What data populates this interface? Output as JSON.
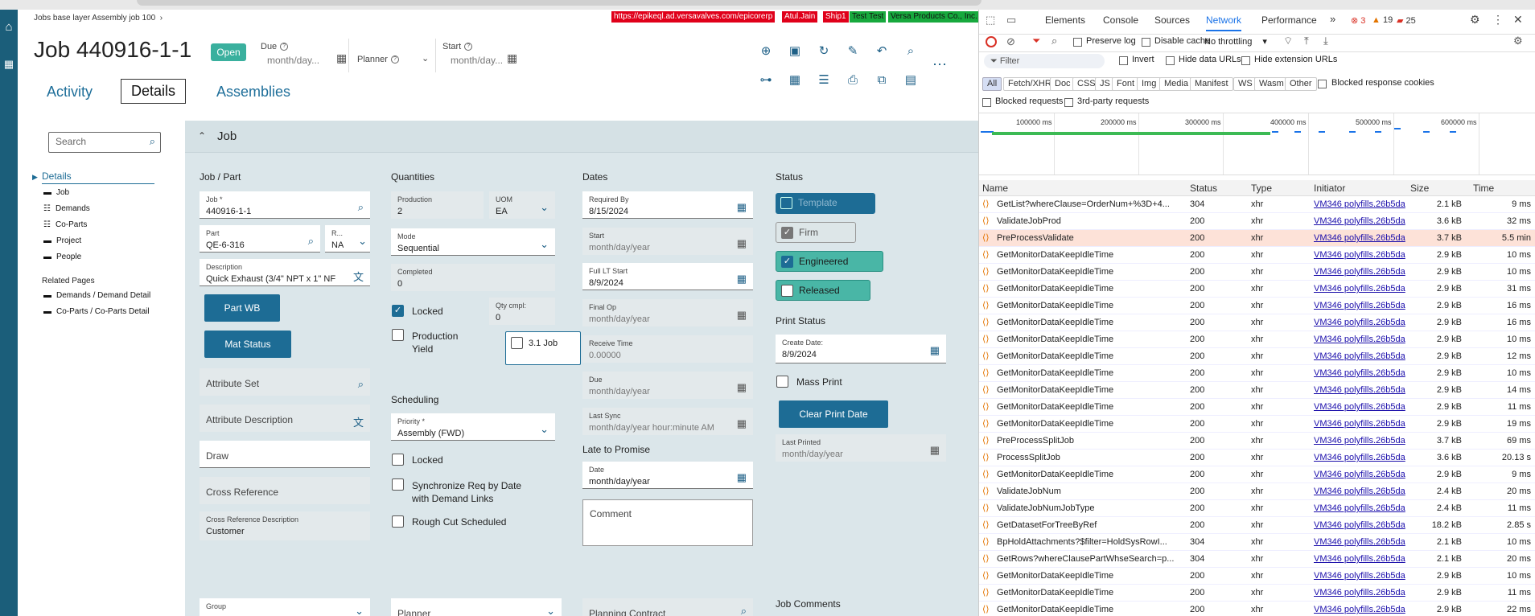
{
  "app": {
    "breadcrumb": "Jobs base layer Assembly job 100",
    "title": "Job 440916-1-1",
    "status_badge": "Open",
    "env": {
      "url": "https://epikeql.ad.versavalves.com/epicorerp",
      "user": "Atul.Jain",
      "ship": "Ship1",
      "test": "Test Test",
      "company": "Versa Products Co., Inc."
    },
    "header": {
      "due_label": "Due",
      "due_value": "month/day...",
      "planner_label": "Planner",
      "start_label": "Start",
      "start_value": "month/day..."
    },
    "tabs": [
      "Activity",
      "Details",
      "Assemblies"
    ],
    "nav": {
      "search_placeholder": "Search",
      "details_label": "Details",
      "items": [
        "Job",
        "Demands",
        "Co-Parts",
        "Project",
        "People"
      ],
      "related_title": "Related Pages",
      "related": [
        "Demands / Demand Detail",
        "Co-Parts / Co-Parts Detail"
      ]
    },
    "section_title": "Job",
    "job_part": {
      "heading": "Job / Part",
      "job_label": "Job *",
      "job_value": "440916-1-1",
      "part_label": "Part",
      "part_value": "QE-6-316",
      "rev_label": "R...",
      "rev_value": "NA",
      "desc_label": "Description",
      "desc_value": "Quick Exhaust (3/4\" NPT x 1\" NF",
      "part_wb": "Part WB",
      "mat_status": "Mat Status",
      "attr_set": "Attribute Set",
      "attr_desc": "Attribute Description",
      "draw": "Draw",
      "cross_ref": "Cross Reference",
      "cross_ref_desc_label": "Cross Reference Description",
      "cross_ref_desc_value": "Customer",
      "group_label": "Group"
    },
    "quantities": {
      "heading": "Quantities",
      "production_label": "Production",
      "production_value": "2",
      "uom_label": "UOM",
      "uom_value": "EA",
      "mode_label": "Mode",
      "mode_value": "Sequential",
      "completed_label": "Completed",
      "completed_value": "0",
      "locked": "Locked",
      "qty_cmpl_label": "Qty cmpl:",
      "qty_cmpl_value": "0",
      "prod_yield": "Production Yield",
      "job31": "3.1 Job",
      "scheduling": "Scheduling",
      "priority_label": "Priority *",
      "priority_value": "Assembly (FWD)",
      "sched_locked": "Locked",
      "sync_req": "Synchronize Req by Date with Demand Links",
      "rough_cut": "Rough Cut Scheduled",
      "planner_label": "Planner"
    },
    "dates": {
      "heading": "Dates",
      "required_label": "Required By",
      "required_value": "8/15/2024",
      "start_label": "Start",
      "start_value": "month/day/year",
      "fulllt_label": "Full LT Start",
      "fulllt_value": "8/9/2024",
      "finalop_label": "Final Op",
      "finalop_value": "month/day/year",
      "receive_label": "Receive Time",
      "receive_value": "0.00000",
      "due_label": "Due",
      "due_value": "month/day/year",
      "lastsync_label": "Last Sync",
      "lastsync_value": "month/day/year hour:minute AM",
      "late_heading": "Late to Promise",
      "date_label": "Date",
      "date_value": "month/day/year",
      "comment_label": "Comment",
      "planning_contract": "Planning Contract"
    },
    "status": {
      "heading": "Status",
      "template": "Template",
      "firm": "Firm",
      "engineered": "Engineered",
      "released": "Released",
      "print_heading": "Print Status",
      "create_label": "Create Date:",
      "create_value": "8/9/2024",
      "mass_print": "Mass Print",
      "clear_print": "Clear Print Date",
      "last_printed_label": "Last Printed",
      "last_printed_value": "month/day/year",
      "job_comments": "Job Comments"
    }
  },
  "devtools": {
    "tabs": [
      "Elements",
      "Console",
      "Sources",
      "Network",
      "Performance"
    ],
    "errors": "3",
    "warnings": "19",
    "issues": "25",
    "preserve_log": "Preserve log",
    "disable_cache": "Disable cache",
    "throttling": "No throttling",
    "filter_placeholder": "Filter",
    "invert": "Invert",
    "hide_data": "Hide data URLs",
    "hide_ext": "Hide extension URLs",
    "types": [
      "All",
      "Fetch/XHR",
      "Doc",
      "CSS",
      "JS",
      "Font",
      "Img",
      "Media",
      "Manifest",
      "WS",
      "Wasm",
      "Other"
    ],
    "blocked_cookies": "Blocked response cookies",
    "blocked_requests": "Blocked requests",
    "third_party": "3rd-party requests",
    "timeline_ticks": [
      "100000 ms",
      "200000 ms",
      "300000 ms",
      "400000 ms",
      "500000 ms",
      "600000 ms"
    ],
    "columns": [
      "Name",
      "Status",
      "Type",
      "Initiator",
      "Size",
      "Time"
    ],
    "rows": [
      [
        "GetList?whereClause=OrderNum+%3D+4...",
        "304",
        "xhr",
        "VM346 polyfills.26b5da",
        "2.1 kB",
        "9 ms"
      ],
      [
        "ValidateJobProd",
        "200",
        "xhr",
        "VM346 polyfills.26b5da",
        "3.6 kB",
        "32 ms"
      ],
      [
        "PreProcessValidate",
        "200",
        "xhr",
        "VM346 polyfills.26b5da",
        "3.7 kB",
        "5.5 min"
      ],
      [
        "GetMonitorDataKeepIdleTime",
        "200",
        "xhr",
        "VM346 polyfills.26b5da",
        "2.9 kB",
        "10 ms"
      ],
      [
        "GetMonitorDataKeepIdleTime",
        "200",
        "xhr",
        "VM346 polyfills.26b5da",
        "2.9 kB",
        "10 ms"
      ],
      [
        "GetMonitorDataKeepIdleTime",
        "200",
        "xhr",
        "VM346 polyfills.26b5da",
        "2.9 kB",
        "31 ms"
      ],
      [
        "GetMonitorDataKeepIdleTime",
        "200",
        "xhr",
        "VM346 polyfills.26b5da",
        "2.9 kB",
        "16 ms"
      ],
      [
        "GetMonitorDataKeepIdleTime",
        "200",
        "xhr",
        "VM346 polyfills.26b5da",
        "2.9 kB",
        "16 ms"
      ],
      [
        "GetMonitorDataKeepIdleTime",
        "200",
        "xhr",
        "VM346 polyfills.26b5da",
        "2.9 kB",
        "10 ms"
      ],
      [
        "GetMonitorDataKeepIdleTime",
        "200",
        "xhr",
        "VM346 polyfills.26b5da",
        "2.9 kB",
        "12 ms"
      ],
      [
        "GetMonitorDataKeepIdleTime",
        "200",
        "xhr",
        "VM346 polyfills.26b5da",
        "2.9 kB",
        "10 ms"
      ],
      [
        "GetMonitorDataKeepIdleTime",
        "200",
        "xhr",
        "VM346 polyfills.26b5da",
        "2.9 kB",
        "14 ms"
      ],
      [
        "GetMonitorDataKeepIdleTime",
        "200",
        "xhr",
        "VM346 polyfills.26b5da",
        "2.9 kB",
        "11 ms"
      ],
      [
        "GetMonitorDataKeepIdleTime",
        "200",
        "xhr",
        "VM346 polyfills.26b5da",
        "2.9 kB",
        "19 ms"
      ],
      [
        "PreProcessSplitJob",
        "200",
        "xhr",
        "VM346 polyfills.26b5da",
        "3.7 kB",
        "69 ms"
      ],
      [
        "ProcessSplitJob",
        "200",
        "xhr",
        "VM346 polyfills.26b5da",
        "3.6 kB",
        "20.13 s"
      ],
      [
        "GetMonitorDataKeepIdleTime",
        "200",
        "xhr",
        "VM346 polyfills.26b5da",
        "2.9 kB",
        "9 ms"
      ],
      [
        "ValidateJobNum",
        "200",
        "xhr",
        "VM346 polyfills.26b5da",
        "2.4 kB",
        "20 ms"
      ],
      [
        "ValidateJobNumJobType",
        "200",
        "xhr",
        "VM346 polyfills.26b5da",
        "2.4 kB",
        "11 ms"
      ],
      [
        "GetDatasetForTreeByRef",
        "200",
        "xhr",
        "VM346 polyfills.26b5da",
        "18.2 kB",
        "2.85 s"
      ],
      [
        "BpHoldAttachments?$filter=HoldSysRowI...",
        "304",
        "xhr",
        "VM346 polyfills.26b5da",
        "2.1 kB",
        "10 ms"
      ],
      [
        "GetRows?whereClausePartWhseSearch=p...",
        "304",
        "xhr",
        "VM346 polyfills.26b5da",
        "2.1 kB",
        "20 ms"
      ],
      [
        "GetMonitorDataKeepIdleTime",
        "200",
        "xhr",
        "VM346 polyfills.26b5da",
        "2.9 kB",
        "10 ms"
      ],
      [
        "GetMonitorDataKeepIdleTime",
        "200",
        "xhr",
        "VM346 polyfills.26b5da",
        "2.9 kB",
        "11 ms"
      ],
      [
        "GetMonitorDataKeepIdleTime",
        "200",
        "xhr",
        "VM346 polyfills.26b5da",
        "2.9 kB",
        "22 ms"
      ]
    ]
  }
}
